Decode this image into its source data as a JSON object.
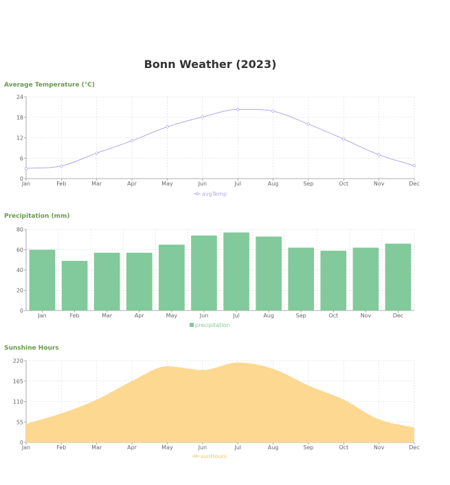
{
  "title": "Bonn Weather (2023)",
  "colors": {
    "section_title": "#6a9a4c",
    "temp_line": "#b3a6e8",
    "precip_bar": "#82c99b",
    "sun_area": "#fdd891",
    "sun_legend": "#f5c26b",
    "grid": "#e0e0e0"
  },
  "chart_data": [
    {
      "type": "line",
      "title": "Average Temperature (°C)",
      "categories": [
        "Jan",
        "Feb",
        "Mar",
        "Apr",
        "May",
        "Jun",
        "Jul",
        "Aug",
        "Sep",
        "Oct",
        "Nov",
        "Dec"
      ],
      "series": [
        {
          "name": "avgTemp",
          "values": [
            3.0,
            3.7,
            7.5,
            11.1,
            15.2,
            18.1,
            20.3,
            19.8,
            16.0,
            11.6,
            7.0,
            3.8
          ]
        }
      ],
      "yticks": [
        0,
        6,
        12,
        18,
        24
      ],
      "ylim": [
        0,
        24
      ],
      "grid": true,
      "legend": "bottom"
    },
    {
      "type": "bar",
      "title": "Precipitation (mm)",
      "categories": [
        "Jan",
        "Feb",
        "Mar",
        "Apr",
        "May",
        "Jun",
        "Jul",
        "Aug",
        "Sep",
        "Oct",
        "Nov",
        "Dec"
      ],
      "series": [
        {
          "name": "precipitation",
          "values": [
            60,
            49,
            57,
            57,
            65,
            74,
            77,
            73,
            62,
            59,
            62,
            66
          ]
        }
      ],
      "yticks": [
        0,
        20,
        40,
        60,
        80
      ],
      "ylim": [
        0,
        80
      ],
      "grid": true,
      "legend": "bottom"
    },
    {
      "type": "area",
      "title": "Sunshine Hours",
      "categories": [
        "Jan",
        "Feb",
        "Mar",
        "Apr",
        "May",
        "Jun",
        "Jul",
        "Aug",
        "Sep",
        "Oct",
        "Nov",
        "Dec"
      ],
      "series": [
        {
          "name": "sunHours",
          "values": [
            50,
            78,
            115,
            165,
            205,
            195,
            215,
            198,
            153,
            115,
            62,
            40
          ]
        }
      ],
      "yticks": [
        0,
        55,
        110,
        165,
        220
      ],
      "ylim": [
        0,
        220
      ],
      "grid": true,
      "legend": "bottom"
    }
  ]
}
